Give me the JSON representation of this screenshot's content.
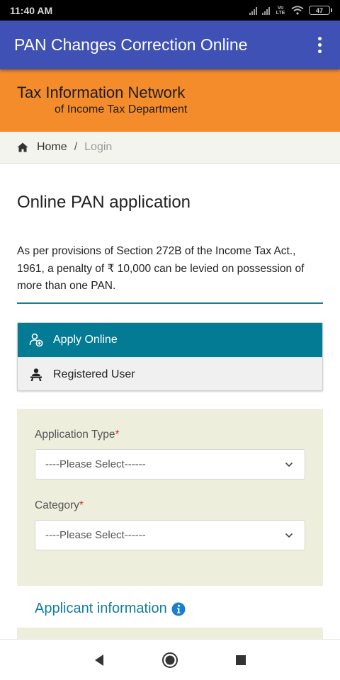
{
  "status_bar": {
    "time": "11:40 AM",
    "volte_label": "Vo LTE",
    "battery": "47"
  },
  "app_bar": {
    "title": "PAN Changes Correction Online",
    "menu_icon": "more-vert-icon"
  },
  "banner": {
    "line1": "Tax Information Network",
    "line2": "of Income Tax Department",
    "bg": "#f58c2c"
  },
  "breadcrumb": {
    "home": "Home",
    "separator": "/",
    "current": "Login"
  },
  "main": {
    "title": "Online PAN application",
    "notice": "As per provisions of Section 272B of the Income Tax Act., 1961, a penalty of ₹ 10,000 can be levied on possession of more than one PAN."
  },
  "tabs": [
    {
      "label": "Apply Online",
      "icon": "add-user-icon",
      "active": true
    },
    {
      "label": "Registered User",
      "icon": "registered-user-icon",
      "active": false
    }
  ],
  "form": {
    "application_type": {
      "label": "Application Type",
      "required_mark": "*",
      "value": "----Please Select------"
    },
    "category": {
      "label": "Category",
      "required_mark": "*",
      "value": "----Please Select------"
    }
  },
  "applicant_section": {
    "title": "Applicant information",
    "icon": "info-icon"
  },
  "colors": {
    "app_bar": "#3f51b5",
    "active_tab": "#047b94",
    "accent_teal": "#137d9b",
    "required": "#d9302b"
  }
}
